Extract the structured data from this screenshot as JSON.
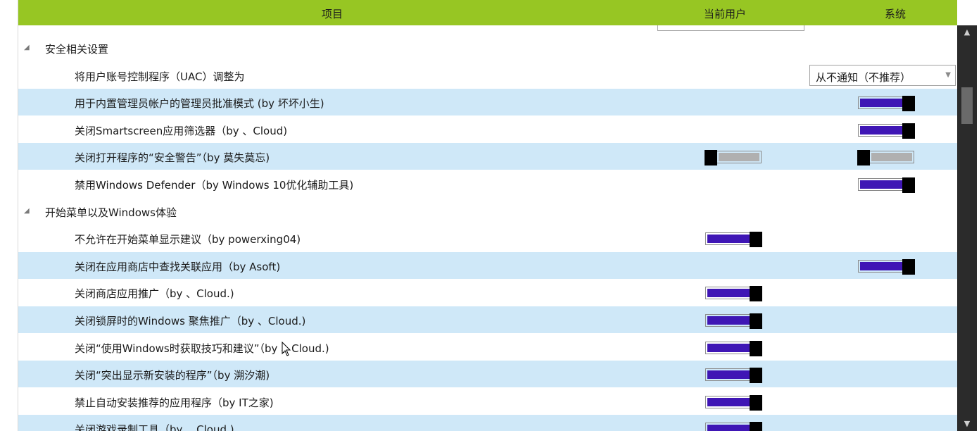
{
  "header": {
    "item": "项目",
    "current_user": "当前用户",
    "system": "系统"
  },
  "colors": {
    "header_bg": "#97c623",
    "row_alt": "#cfe8f8",
    "toggle_on": "#3f16b5",
    "toggle_off": "#b0b0b0"
  },
  "icons": {
    "expand": "triangle-down-icon",
    "scroll_up": "triangle-up-icon",
    "scroll_down": "triangle-down-icon"
  },
  "rows": [
    {
      "type": "group",
      "label": "安全相关设置"
    },
    {
      "type": "item",
      "label": "将用户账号控制程序（UAC）调整为",
      "dropdown": "从不通知（不推荐）"
    },
    {
      "type": "item",
      "alt": true,
      "label": "用于内置管理员帐户的管理员批准模式 (by 坏坏小生)",
      "system": "on"
    },
    {
      "type": "item",
      "label": "关闭Smartscreen应用筛选器（by 、Cloud)",
      "system": "on"
    },
    {
      "type": "item",
      "alt": true,
      "label": "关闭打开程序的“安全警告”（by 莫失莫忘)",
      "user": "off",
      "system": "off"
    },
    {
      "type": "item",
      "label": "禁用Windows Defender（by Windows 10优化辅助工具)",
      "system": "on"
    },
    {
      "type": "group",
      "label": "开始菜单以及Windows体验"
    },
    {
      "type": "item",
      "label": "不允许在开始菜单显示建议（by powerxing04)",
      "user": "on"
    },
    {
      "type": "item",
      "alt": true,
      "label": "关闭在应用商店中查找关联应用（by Asoft)",
      "system": "on"
    },
    {
      "type": "item",
      "label": "关闭商店应用推广（by 、Cloud.)",
      "user": "on"
    },
    {
      "type": "item",
      "alt": true,
      "label": "关闭锁屏时的Windows 聚焦推广（by 、Cloud.)",
      "user": "on"
    },
    {
      "type": "item",
      "label": "关闭“使用Windows时获取技巧和建议”（by 、Cloud.)",
      "user": "on"
    },
    {
      "type": "item",
      "alt": true,
      "label": "关闭“突出显示新安装的程序”（by 溯汐潮)",
      "user": "on"
    },
    {
      "type": "item",
      "label": "禁止自动安装推荐的应用程序（by IT之家)",
      "user": "on"
    },
    {
      "type": "item",
      "alt": true,
      "label": "关闭游戏录制工具（by 、Cloud.)",
      "user": "on"
    }
  ]
}
